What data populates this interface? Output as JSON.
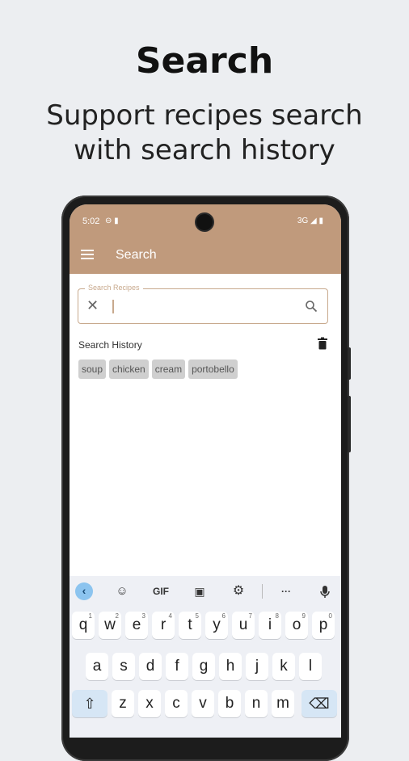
{
  "headline": "Search",
  "subline": [
    "Support recipes search",
    "with search history"
  ],
  "status": {
    "time": "5:02",
    "network": "3G"
  },
  "appbar": {
    "title": "Search"
  },
  "search": {
    "label": "Search Recipes",
    "value": "",
    "placeholder": ""
  },
  "history": {
    "title": "Search History",
    "chips": [
      "soup",
      "chicken",
      "cream",
      "portobello"
    ]
  },
  "keyboard": {
    "gif_label": "GIF",
    "more_label": "···",
    "row1": [
      "q",
      "w",
      "e",
      "r",
      "t",
      "y",
      "u",
      "i",
      "o",
      "p"
    ],
    "row1_hints": [
      "1",
      "2",
      "3",
      "4",
      "5",
      "6",
      "7",
      "8",
      "9",
      "0"
    ],
    "row2": [
      "a",
      "s",
      "d",
      "f",
      "g",
      "h",
      "j",
      "k",
      "l"
    ],
    "row3": [
      "z",
      "x",
      "c",
      "v",
      "b",
      "n",
      "m"
    ],
    "shift_symbol": "⇧",
    "backspace_symbol": "⌫"
  },
  "colors": {
    "accent": "#c09a7c",
    "page_bg": "#eceef1"
  },
  "icons": [
    "menu-icon",
    "clear-icon",
    "search-icon",
    "trash-icon",
    "back-icon",
    "sticker-icon",
    "clipboard-icon",
    "gear-icon",
    "mic-icon"
  ]
}
